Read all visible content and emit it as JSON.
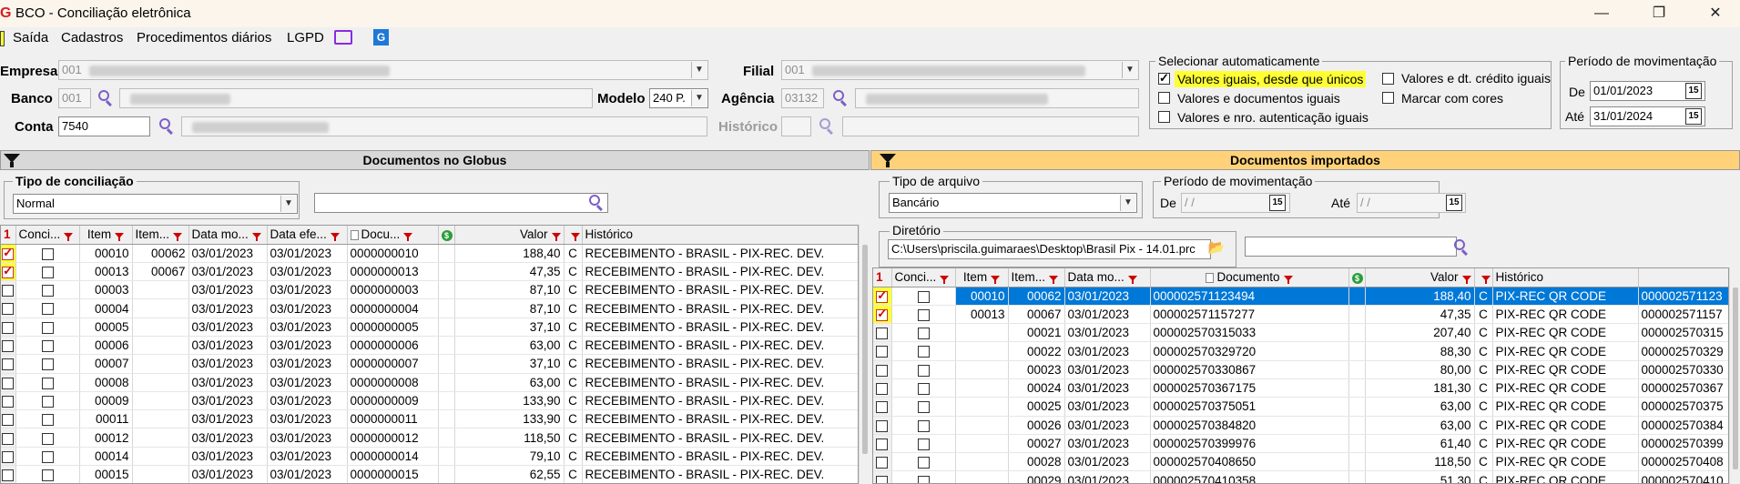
{
  "window": {
    "icon_letter": "G",
    "title": "BCO - Conciliação eletrônica",
    "minimize": "—",
    "maximize": "❐",
    "close": "✕"
  },
  "menu": {
    "saida": "Saída",
    "cadastros": "Cadastros",
    "procedimentos": "Procedimentos diários",
    "lgpd": "LGPD"
  },
  "form": {
    "empresa": {
      "label": "Empresa",
      "code": "001"
    },
    "banco": {
      "label": "Banco",
      "code": "001"
    },
    "modelo": {
      "label": "Modelo",
      "value": "240 P."
    },
    "conta": {
      "label": "Conta",
      "value": "7540"
    },
    "filial": {
      "label": "Filial",
      "code": "001"
    },
    "agencia": {
      "label": "Agência",
      "code": "03132"
    },
    "historico": {
      "label": "Histórico"
    }
  },
  "auto_select": {
    "title": "Selecionar automaticamente",
    "options": [
      {
        "label": "Valores iguais, desde que únicos",
        "checked": true
      },
      {
        "label": "Valores e documentos iguais",
        "checked": false
      },
      {
        "label": "Valores e nro. autenticação iguais",
        "checked": false
      },
      {
        "label": "Valores e dt. crédito iguais",
        "checked": false
      },
      {
        "label": "Marcar com cores",
        "checked": false
      }
    ]
  },
  "period_main": {
    "title": "Período de movimentação",
    "de_label": "De",
    "de_value": "01/01/2023",
    "ate_label": "Até",
    "ate_value": "31/01/2024"
  },
  "left_panel": {
    "header": "Documentos no Globus",
    "tipo_title": "Tipo de conciliação",
    "tipo_value": "Normal",
    "columns": [
      "1",
      "Conci...",
      "Item",
      "Item...",
      "Data mo...",
      "Data efe...",
      "Docu...",
      "",
      "Valor",
      "",
      "Histórico"
    ],
    "rows": [
      {
        "checked": true,
        "item": "00010",
        "item2": "00062",
        "dmov": "03/01/2023",
        "defe": "03/01/2023",
        "doc": "0000000010",
        "valor": "188,40",
        "c": "C",
        "hist": "RECEBIMENTO - BRASIL - PIX-REC. DEV."
      },
      {
        "checked": true,
        "item": "00013",
        "item2": "00067",
        "dmov": "03/01/2023",
        "defe": "03/01/2023",
        "doc": "0000000013",
        "valor": "47,35",
        "c": "C",
        "hist": "RECEBIMENTO - BRASIL - PIX-REC. DEV."
      },
      {
        "checked": false,
        "item": "00003",
        "item2": "",
        "dmov": "03/01/2023",
        "defe": "03/01/2023",
        "doc": "0000000003",
        "valor": "87,10",
        "c": "C",
        "hist": "RECEBIMENTO - BRASIL - PIX-REC. DEV."
      },
      {
        "checked": false,
        "item": "00004",
        "item2": "",
        "dmov": "03/01/2023",
        "defe": "03/01/2023",
        "doc": "0000000004",
        "valor": "87,10",
        "c": "C",
        "hist": "RECEBIMENTO - BRASIL - PIX-REC. DEV."
      },
      {
        "checked": false,
        "item": "00005",
        "item2": "",
        "dmov": "03/01/2023",
        "defe": "03/01/2023",
        "doc": "0000000005",
        "valor": "37,10",
        "c": "C",
        "hist": "RECEBIMENTO - BRASIL - PIX-REC. DEV."
      },
      {
        "checked": false,
        "item": "00006",
        "item2": "",
        "dmov": "03/01/2023",
        "defe": "03/01/2023",
        "doc": "0000000006",
        "valor": "63,00",
        "c": "C",
        "hist": "RECEBIMENTO - BRASIL - PIX-REC. DEV."
      },
      {
        "checked": false,
        "item": "00007",
        "item2": "",
        "dmov": "03/01/2023",
        "defe": "03/01/2023",
        "doc": "0000000007",
        "valor": "37,10",
        "c": "C",
        "hist": "RECEBIMENTO - BRASIL - PIX-REC. DEV."
      },
      {
        "checked": false,
        "item": "00008",
        "item2": "",
        "dmov": "03/01/2023",
        "defe": "03/01/2023",
        "doc": "0000000008",
        "valor": "63,00",
        "c": "C",
        "hist": "RECEBIMENTO - BRASIL - PIX-REC. DEV."
      },
      {
        "checked": false,
        "item": "00009",
        "item2": "",
        "dmov": "03/01/2023",
        "defe": "03/01/2023",
        "doc": "0000000009",
        "valor": "133,90",
        "c": "C",
        "hist": "RECEBIMENTO - BRASIL - PIX-REC. DEV."
      },
      {
        "checked": false,
        "item": "00011",
        "item2": "",
        "dmov": "03/01/2023",
        "defe": "03/01/2023",
        "doc": "0000000011",
        "valor": "133,90",
        "c": "C",
        "hist": "RECEBIMENTO - BRASIL - PIX-REC. DEV."
      },
      {
        "checked": false,
        "item": "00012",
        "item2": "",
        "dmov": "03/01/2023",
        "defe": "03/01/2023",
        "doc": "0000000012",
        "valor": "118,50",
        "c": "C",
        "hist": "RECEBIMENTO - BRASIL - PIX-REC. DEV."
      },
      {
        "checked": false,
        "item": "00014",
        "item2": "",
        "dmov": "03/01/2023",
        "defe": "03/01/2023",
        "doc": "0000000014",
        "valor": "79,10",
        "c": "C",
        "hist": "RECEBIMENTO - BRASIL - PIX-REC. DEV."
      },
      {
        "checked": false,
        "item": "00015",
        "item2": "",
        "dmov": "03/01/2023",
        "defe": "03/01/2023",
        "doc": "0000000015",
        "valor": "62,55",
        "c": "C",
        "hist": "RECEBIMENTO - BRASIL - PIX-REC. DEV."
      }
    ]
  },
  "right_panel": {
    "header": "Documentos importados",
    "tipo_arquivo_title": "Tipo de arquivo",
    "tipo_arquivo_value": "Bancário",
    "periodo_title": "Período de movimentação",
    "de_label": "De",
    "de_value": " / /",
    "ate_label": "Até",
    "ate_value": " / /",
    "diretorio_title": "Diretório",
    "diretorio_value": "C:\\Users\\priscila.guimaraes\\Desktop\\Brasil Pix - 14.01.prc",
    "columns": [
      "1",
      "Conci...",
      "Item",
      "Item...",
      "Data mo...",
      "Documento",
      "",
      "Valor",
      "",
      "Histórico",
      ""
    ],
    "rows": [
      {
        "checked": true,
        "item": "00010",
        "item2": "00062",
        "dmov": "03/01/2023",
        "doc": "000002571123494",
        "valor": "188,40",
        "c": "C",
        "hist": "PIX-REC QR CODE",
        "extra": "000002571123",
        "selected": true
      },
      {
        "checked": true,
        "item": "00013",
        "item2": "00067",
        "dmov": "03/01/2023",
        "doc": "000002571157277",
        "valor": "47,35",
        "c": "C",
        "hist": "PIX-REC QR CODE",
        "extra": "000002571157"
      },
      {
        "checked": false,
        "item": "",
        "item2": "00021",
        "dmov": "03/01/2023",
        "doc": "000002570315033",
        "valor": "207,40",
        "c": "C",
        "hist": "PIX-REC QR CODE",
        "extra": "000002570315"
      },
      {
        "checked": false,
        "item": "",
        "item2": "00022",
        "dmov": "03/01/2023",
        "doc": "000002570329720",
        "valor": "88,30",
        "c": "C",
        "hist": "PIX-REC QR CODE",
        "extra": "000002570329"
      },
      {
        "checked": false,
        "item": "",
        "item2": "00023",
        "dmov": "03/01/2023",
        "doc": "000002570330867",
        "valor": "80,00",
        "c": "C",
        "hist": "PIX-REC QR CODE",
        "extra": "000002570330"
      },
      {
        "checked": false,
        "item": "",
        "item2": "00024",
        "dmov": "03/01/2023",
        "doc": "000002570367175",
        "valor": "181,30",
        "c": "C",
        "hist": "PIX-REC QR CODE",
        "extra": "000002570367"
      },
      {
        "checked": false,
        "item": "",
        "item2": "00025",
        "dmov": "03/01/2023",
        "doc": "000002570375051",
        "valor": "63,00",
        "c": "C",
        "hist": "PIX-REC QR CODE",
        "extra": "000002570375"
      },
      {
        "checked": false,
        "item": "",
        "item2": "00026",
        "dmov": "03/01/2023",
        "doc": "000002570384820",
        "valor": "63,00",
        "c": "C",
        "hist": "PIX-REC QR CODE",
        "extra": "000002570384"
      },
      {
        "checked": false,
        "item": "",
        "item2": "00027",
        "dmov": "03/01/2023",
        "doc": "000002570399976",
        "valor": "61,40",
        "c": "C",
        "hist": "PIX-REC QR CODE",
        "extra": "000002570399"
      },
      {
        "checked": false,
        "item": "",
        "item2": "00028",
        "dmov": "03/01/2023",
        "doc": "000002570408650",
        "valor": "118,50",
        "c": "C",
        "hist": "PIX-REC QR CODE",
        "extra": "000002570408"
      },
      {
        "checked": false,
        "item": "",
        "item2": "00029",
        "dmov": "03/01/2023",
        "doc": "000002570410358",
        "valor": "51,30",
        "c": "C",
        "hist": "PIX-REC QR CODE",
        "extra": "000002570410"
      }
    ]
  },
  "colors": {
    "highlight": "#ffff33",
    "selection": "#0078d7",
    "header_orange": "#ffd27a",
    "search_icon": "#7d5fc6"
  }
}
